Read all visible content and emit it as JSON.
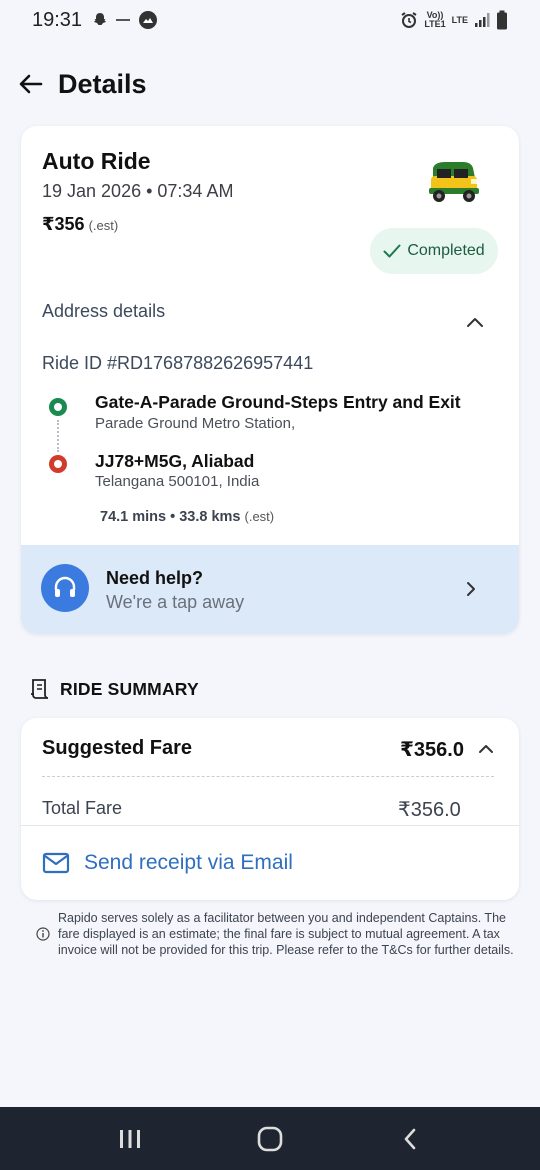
{
  "status_bar": {
    "time": "19:31",
    "left_icons": [
      "snapchat-icon",
      "signal-dots-icon",
      "app-icon"
    ],
    "right_icons": [
      "alarm-icon",
      "volte-icon",
      "lte-icon",
      "signal-icon",
      "battery-icon"
    ],
    "volte_text": "Vo))",
    "lte1_text": "LTE1",
    "lte_text": "LTE"
  },
  "header": {
    "title": "Details",
    "back_icon": "back-arrow-icon"
  },
  "ride": {
    "title": "Auto Ride",
    "datetime": "19 Jan 2026 • 07:34 AM",
    "fare": "₹356",
    "fare_suffix": "(.est)",
    "vehicle_icon": "auto-rickshaw-icon",
    "status": "Completed",
    "status_color": "#e7f6ef",
    "address_label": "Address details",
    "ride_id": "Ride ID #RD17687882626957441",
    "pickup": {
      "name": "Gate-A-Parade Ground-Steps Entry and Exit",
      "sub": "Parade Ground Metro Station,"
    },
    "drop": {
      "name": "JJ78+M5G, Aliabad",
      "sub": "Telangana 500101, India"
    },
    "trip_stats": "74.1 mins • 33.8 kms",
    "trip_stats_suffix": "(.est)"
  },
  "help": {
    "title": "Need help?",
    "subtitle": "We're a tap away",
    "icon": "headset-icon"
  },
  "summary": {
    "heading": "RIDE SUMMARY",
    "suggested_fare_label": "Suggested Fare",
    "suggested_fare_value": "₹356.0",
    "total_fare_label": "Total Fare",
    "total_fare_value": "₹356.0",
    "receipt_label": "Send receipt via Email"
  },
  "disclaimer": "Rapido serves solely as a facilitator between you and independent Captains. The fare displayed is an estimate; the final fare is subject to mutual agreement. A tax invoice will not be provided for this trip. Please refer to the T&Cs for further details.",
  "colors": {
    "accent": "#2f6fbd",
    "pickup": "#1a8a4f",
    "drop": "#d23b2c",
    "help_bg": "#dce9f8"
  }
}
